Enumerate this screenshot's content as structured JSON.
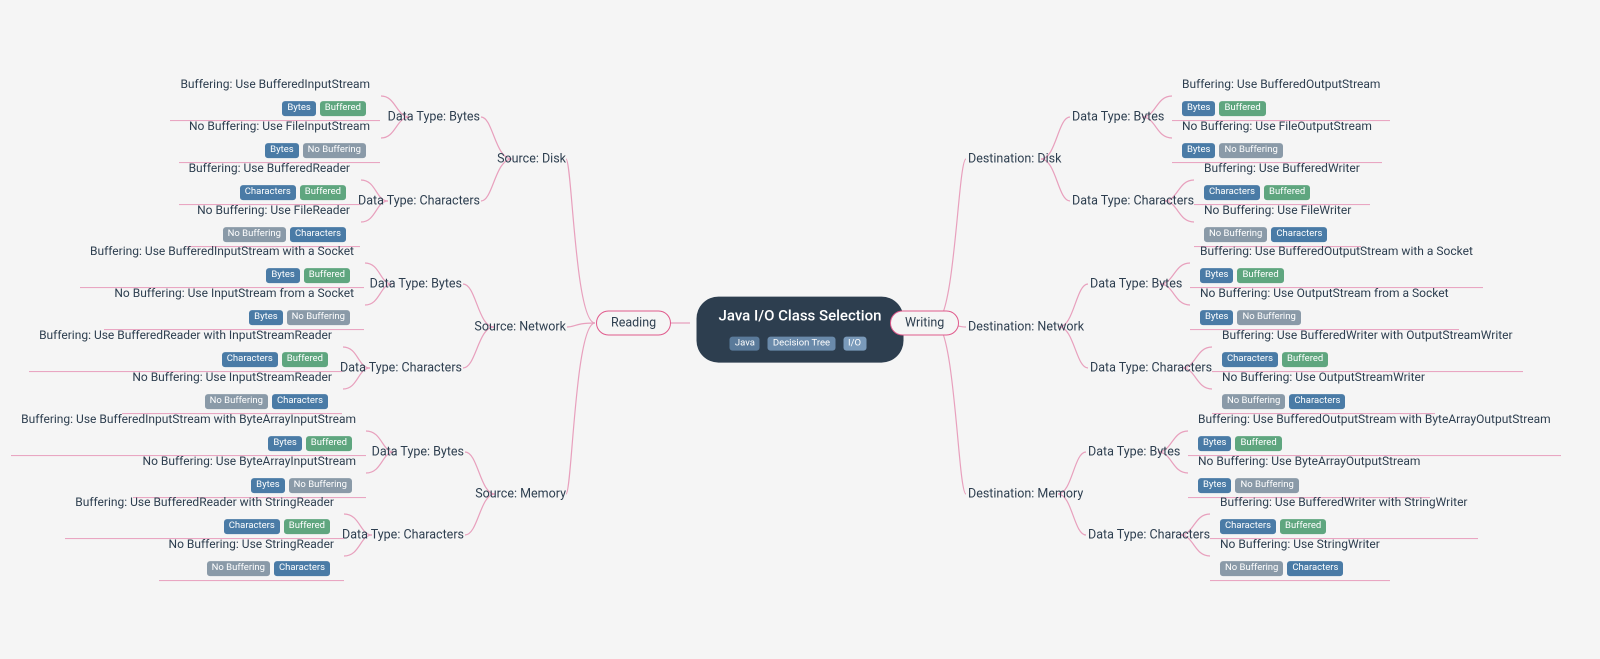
{
  "root": {
    "title": "Java I/O Class Selection",
    "tags": [
      "Java",
      "Decision Tree",
      "I/O"
    ]
  },
  "ops": {
    "reading": "Reading",
    "writing": "Writing"
  },
  "read": {
    "disk": {
      "label": "Source: Disk",
      "bytes": {
        "label": "Data Type: Bytes",
        "buf": {
          "label": "Buffering: Use BufferedInputStream",
          "t": [
            "Bytes",
            "Buffered"
          ]
        },
        "nobuf": {
          "label": "No Buffering: Use FileInputStream",
          "t": [
            "Bytes",
            "No Buffering"
          ]
        }
      },
      "chars": {
        "label": "Data Type: Characters",
        "buf": {
          "label": "Buffering: Use BufferedReader",
          "t": [
            "Characters",
            "Buffered"
          ]
        },
        "nobuf": {
          "label": "No Buffering: Use FileReader",
          "t": [
            "No Buffering",
            "Characters"
          ]
        }
      }
    },
    "network": {
      "label": "Source: Network",
      "bytes": {
        "label": "Data Type: Bytes",
        "buf": {
          "label": "Buffering: Use BufferedInputStream with a Socket",
          "t": [
            "Bytes",
            "Buffered"
          ]
        },
        "nobuf": {
          "label": "No Buffering: Use InputStream from a Socket",
          "t": [
            "Bytes",
            "No Buffering"
          ]
        }
      },
      "chars": {
        "label": "Data Type: Characters",
        "buf": {
          "label": "Buffering: Use BufferedReader with InputStreamReader",
          "t": [
            "Characters",
            "Buffered"
          ]
        },
        "nobuf": {
          "label": "No Buffering: Use InputStreamReader",
          "t": [
            "No Buffering",
            "Characters"
          ]
        }
      }
    },
    "memory": {
      "label": "Source: Memory",
      "bytes": {
        "label": "Data Type: Bytes",
        "buf": {
          "label": "Buffering: Use BufferedInputStream with ByteArrayInputStream",
          "t": [
            "Bytes",
            "Buffered"
          ]
        },
        "nobuf": {
          "label": "No Buffering: Use ByteArrayInputStream",
          "t": [
            "Bytes",
            "No Buffering"
          ]
        }
      },
      "chars": {
        "label": "Data Type: Characters",
        "buf": {
          "label": "Buffering: Use BufferedReader with StringReader",
          "t": [
            "Characters",
            "Buffered"
          ]
        },
        "nobuf": {
          "label": "No Buffering: Use StringReader",
          "t": [
            "No Buffering",
            "Characters"
          ]
        }
      }
    }
  },
  "write": {
    "disk": {
      "label": "Destination: Disk",
      "bytes": {
        "label": "Data Type: Bytes",
        "buf": {
          "label": "Buffering: Use BufferedOutputStream",
          "t": [
            "Bytes",
            "Buffered"
          ]
        },
        "nobuf": {
          "label": "No Buffering: Use FileOutputStream",
          "t": [
            "Bytes",
            "No Buffering"
          ]
        }
      },
      "chars": {
        "label": "Data Type: Characters",
        "buf": {
          "label": "Buffering: Use BufferedWriter",
          "t": [
            "Characters",
            "Buffered"
          ]
        },
        "nobuf": {
          "label": "No Buffering: Use FileWriter",
          "t": [
            "No Buffering",
            "Characters"
          ]
        }
      }
    },
    "network": {
      "label": "Destination: Network",
      "bytes": {
        "label": "Data Type: Bytes",
        "buf": {
          "label": "Buffering: Use BufferedOutputStream with a Socket",
          "t": [
            "Bytes",
            "Buffered"
          ]
        },
        "nobuf": {
          "label": "No Buffering: Use OutputStream from a Socket",
          "t": [
            "Bytes",
            "No Buffering"
          ]
        }
      },
      "chars": {
        "label": "Data Type: Characters",
        "buf": {
          "label": "Buffering: Use BufferedWriter with OutputStreamWriter",
          "t": [
            "Characters",
            "Buffered"
          ]
        },
        "nobuf": {
          "label": "No Buffering: Use OutputStreamWriter",
          "t": [
            "No Buffering",
            "Characters"
          ]
        }
      }
    },
    "memory": {
      "label": "Destination: Memory",
      "bytes": {
        "label": "Data Type: Bytes",
        "buf": {
          "label": "Buffering: Use BufferedOutputStream with ByteArrayOutputStream",
          "t": [
            "Bytes",
            "Buffered"
          ]
        },
        "nobuf": {
          "label": "No Buffering: Use ByteArrayOutputStream",
          "t": [
            "Bytes",
            "No Buffering"
          ]
        }
      },
      "chars": {
        "label": "Data Type: Characters",
        "buf": {
          "label": "Buffering: Use BufferedWriter with StringWriter",
          "t": [
            "Characters",
            "Buffered"
          ]
        },
        "nobuf": {
          "label": "No Buffering: Use StringWriter",
          "t": [
            "No Buffering",
            "Characters"
          ]
        }
      }
    }
  },
  "tagClass": {
    "Bytes": "blue",
    "Characters": "blue",
    "Buffered": "green",
    "No Buffering": "gray"
  }
}
